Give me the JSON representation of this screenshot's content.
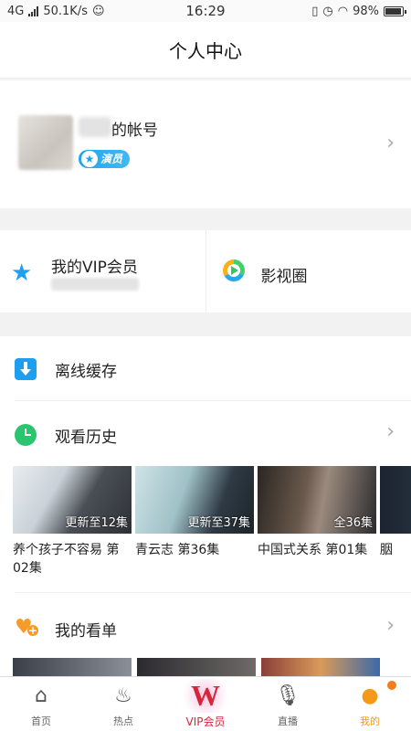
{
  "status_bar": {
    "network": "4G",
    "speed": "50.1K/s",
    "time": "16:29",
    "battery": "98%"
  },
  "header": {
    "title": "个人中心"
  },
  "profile": {
    "account_label": "的帐号",
    "role_badge": "演员"
  },
  "vip_row": {
    "vip_label": "我的VIP会员",
    "circle_label": "影视圈"
  },
  "list": {
    "offline": "离线缓存",
    "history": "观看历史",
    "watchlist": "我的看单"
  },
  "history_items": [
    {
      "title": "养个孩子不容易 第02集",
      "episode": "更新至12集"
    },
    {
      "title": "青云志 第36集",
      "episode": "更新至37集"
    },
    {
      "title": "中国式关系 第01集",
      "episode": "全36集"
    },
    {
      "title": "胭",
      "episode": ""
    }
  ],
  "tabs": [
    {
      "label": "首页",
      "icon": "home-icon"
    },
    {
      "label": "热点",
      "icon": "flame-icon"
    },
    {
      "label": "VIP会员",
      "icon": "vip-logo-icon"
    },
    {
      "label": "直播",
      "icon": "microphone-icon"
    },
    {
      "label": "我的",
      "icon": "person-icon"
    }
  ],
  "colors": {
    "accent": "#f39a1b",
    "badge_blue": "#1fa4ef",
    "vip_red": "#d6263b"
  }
}
